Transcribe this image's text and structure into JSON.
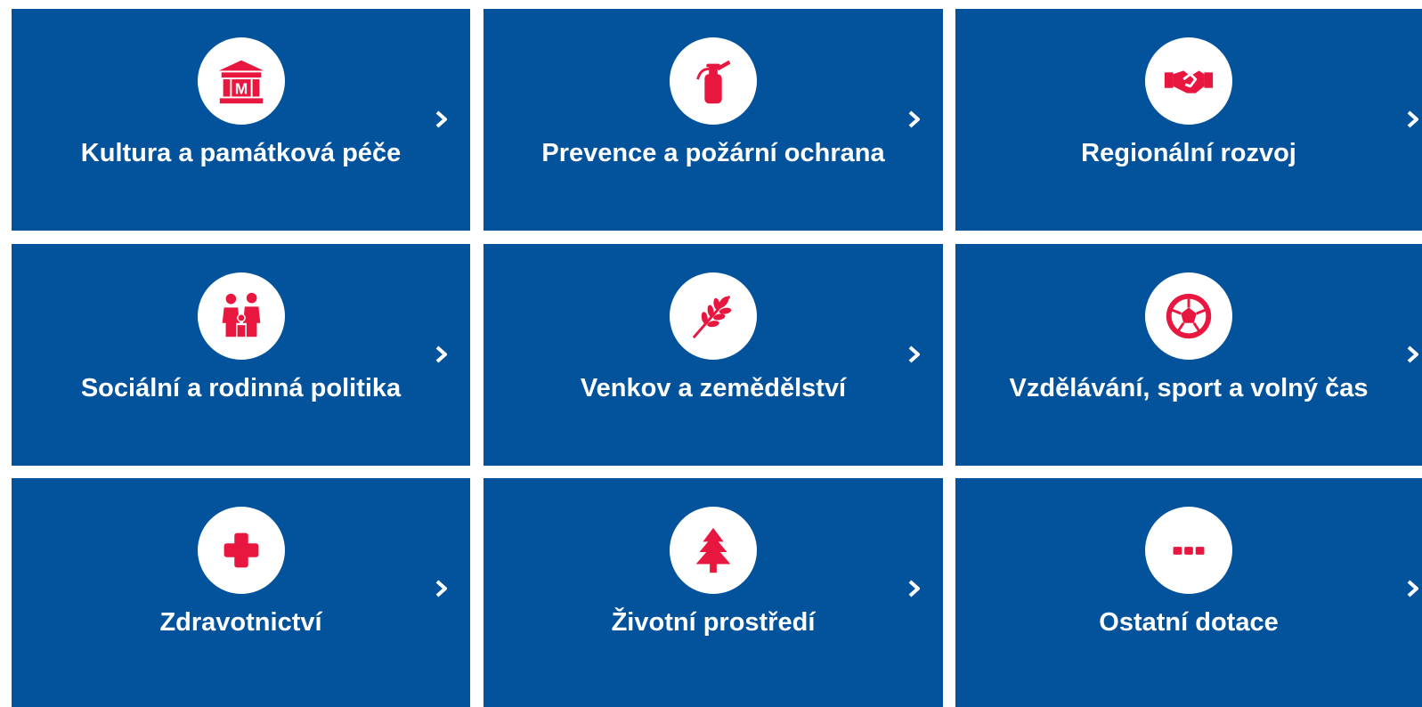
{
  "accent_color": "#e8173f",
  "tile_color": "#03529c",
  "tiles": [
    {
      "label": "Kultura a památková péče",
      "icon": "museum-icon"
    },
    {
      "label": "Prevence a požární ochrana",
      "icon": "fire-extinguisher-icon"
    },
    {
      "label": "Regionální rozvoj",
      "icon": "handshake-icon"
    },
    {
      "label": "Sociální a rodinná politika",
      "icon": "family-icon"
    },
    {
      "label": "Venkov a zemědělství",
      "icon": "wheat-icon"
    },
    {
      "label": "Vzdělávání, sport a volný čas",
      "icon": "soccer-ball-icon"
    },
    {
      "label": "Zdravotnictví",
      "icon": "medical-cross-icon"
    },
    {
      "label": "Životní prostředí",
      "icon": "tree-icon"
    },
    {
      "label": "Ostatní dotace",
      "icon": "more-dots-icon"
    }
  ]
}
